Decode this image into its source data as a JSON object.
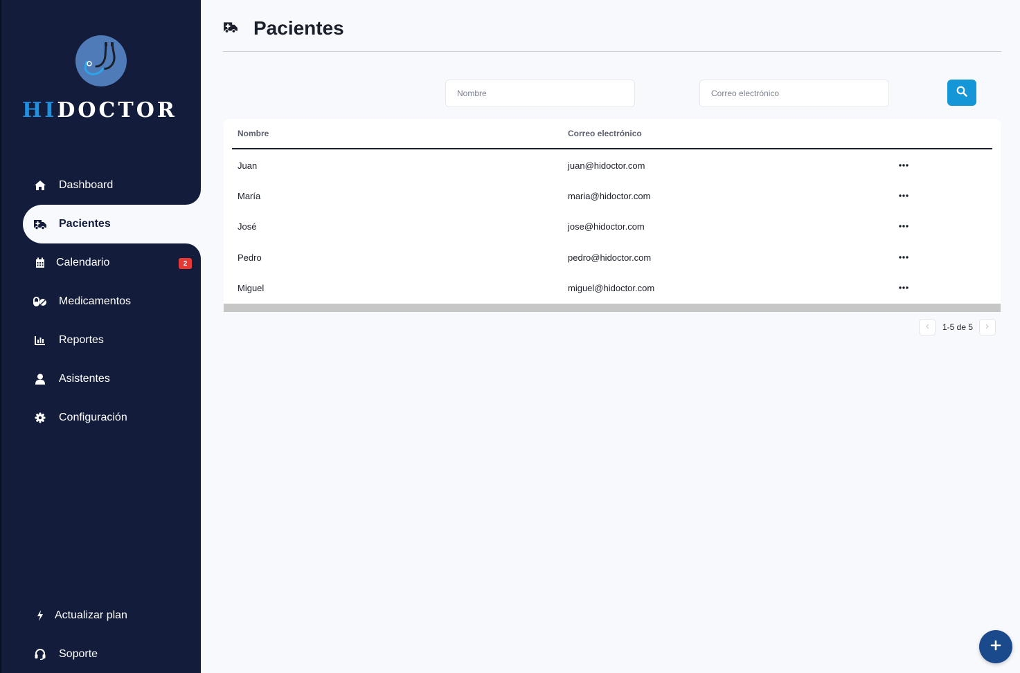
{
  "brand": {
    "hi": "HI",
    "doctor": "DOCTOR"
  },
  "sidebar": {
    "items": [
      {
        "label": "Dashboard",
        "icon": "home-icon"
      },
      {
        "label": "Pacientes",
        "icon": "ambulance-icon",
        "active": true
      },
      {
        "label": "Calendario",
        "icon": "calendar-icon",
        "badge": "2"
      },
      {
        "label": "Medicamentos",
        "icon": "pills-icon"
      },
      {
        "label": "Reportes",
        "icon": "chart-icon"
      },
      {
        "label": "Asistentes",
        "icon": "user-icon"
      },
      {
        "label": "Configuración",
        "icon": "gear-icon"
      }
    ],
    "bottom": [
      {
        "label": "Actualizar plan",
        "icon": "bolt-icon"
      },
      {
        "label": "Soporte",
        "icon": "headset-icon"
      }
    ]
  },
  "header": {
    "title": "Pacientes",
    "icon": "ambulance-icon"
  },
  "filters": {
    "name_placeholder": "Nombre",
    "email_placeholder": "Correo electrónico",
    "name_value": "",
    "email_value": ""
  },
  "table": {
    "columns": [
      "Nombre",
      "Correo electrónico"
    ],
    "rows": [
      {
        "name": "Juan",
        "email": "juan@hidoctor.com"
      },
      {
        "name": "María",
        "email": "maria@hidoctor.com"
      },
      {
        "name": "José",
        "email": "jose@hidoctor.com"
      },
      {
        "name": "Pedro",
        "email": "pedro@hidoctor.com"
      },
      {
        "name": "Miguel",
        "email": "miguel@hidoctor.com"
      }
    ]
  },
  "pagination": {
    "label": "1-5 de 5"
  },
  "colors": {
    "sidebar": "#131d3b",
    "accent": "#1596d6",
    "badge": "#e53935",
    "fab": "#1b4a8c"
  }
}
